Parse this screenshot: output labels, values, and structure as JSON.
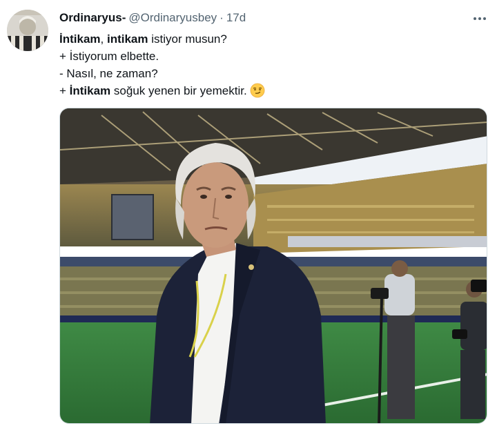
{
  "tweet": {
    "author": {
      "display_name": "Ordinaryus-",
      "handle": "@Ordinaryusbey",
      "separator": "·",
      "time": "17d",
      "avatar_icon": "user-avatar"
    },
    "more_icon": "more-options-icon",
    "lines": [
      [
        {
          "text": "İntikam",
          "bold": true
        },
        {
          "text": ", ",
          "bold": false
        },
        {
          "text": "intikam",
          "bold": true
        },
        {
          "text": " istiyor musun?",
          "bold": false
        }
      ],
      [
        {
          "text": "+ İstiyorum elbette.",
          "bold": false
        }
      ],
      [
        {
          "text": "- Nasıl, ne zaman?",
          "bold": false
        }
      ],
      [
        {
          "text": "+ ",
          "bold": false
        },
        {
          "text": "İntikam",
          "bold": true
        },
        {
          "text": " soğuk yenen bir yemektir.",
          "bold": false
        }
      ]
    ],
    "emoji_icon": "smirking-face-emoji",
    "media": {
      "kind": "photo",
      "icon": "stadium-photo",
      "colors": {
        "pitch": "#2f7a38",
        "crowd": "#8a7a4a",
        "roof": "#3a3a3a",
        "suit": "#1c2238"
      }
    }
  }
}
